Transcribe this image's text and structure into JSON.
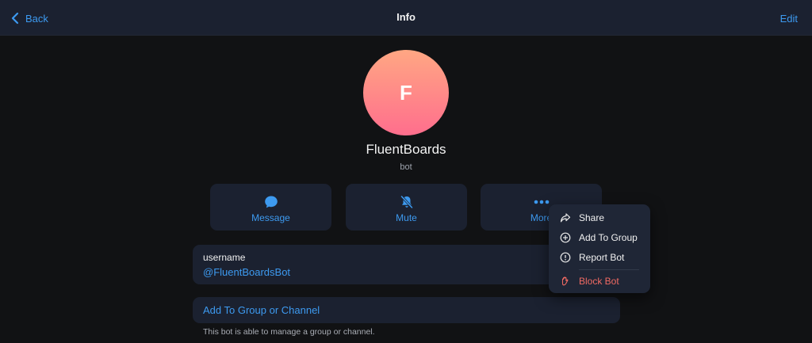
{
  "header": {
    "back_label": "Back",
    "title": "Info",
    "edit_label": "Edit"
  },
  "profile": {
    "avatar_initial": "F",
    "name": "FluentBoards",
    "subtitle": "bot"
  },
  "actions": [
    {
      "label": "Message",
      "icon": "message-bubble-icon"
    },
    {
      "label": "Mute",
      "icon": "bell-muted-icon"
    },
    {
      "label": "More",
      "icon": "more-dots-icon"
    }
  ],
  "username_card": {
    "label": "username",
    "value": "@FluentBoardsBot"
  },
  "add_card": {
    "label": "Add To Group or Channel",
    "footnote": "This bot is able to manage a group or channel."
  },
  "more_menu": {
    "items": [
      {
        "label": "Share",
        "icon": "share-arrow-icon"
      },
      {
        "label": "Add To Group",
        "icon": "plus-circle-icon"
      },
      {
        "label": "Report Bot",
        "icon": "info-circle-icon"
      },
      {
        "label": "Block Bot",
        "icon": "hand-block-icon"
      }
    ]
  },
  "colors": {
    "accent": "#3d9af0",
    "danger": "#f06a63",
    "background": "#111214",
    "surface": "#1b2130"
  }
}
